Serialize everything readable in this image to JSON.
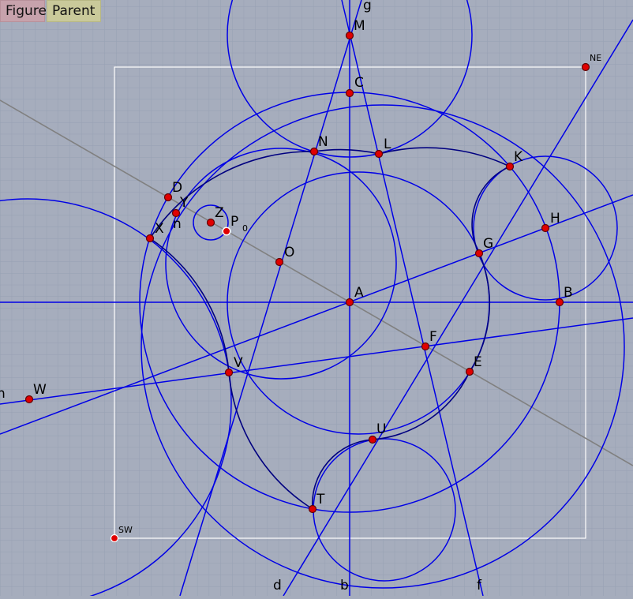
{
  "toolbar": {
    "figure_label": "Figure",
    "parent_label": "Parent"
  },
  "colors": {
    "background": "#a6adbd",
    "grid": "#97a0b3",
    "construction_blue": "#0000e6",
    "arc_dark_blue": "#000080",
    "gray_line": "#808080",
    "frame": "#ffffff",
    "point_fill": "#e00000",
    "point_stroke": "#600000"
  },
  "points": {
    "M": "M",
    "C": "C",
    "N": "N",
    "L": "L",
    "K": "K",
    "NE": "NE",
    "D": "D",
    "Y": "Y",
    "Z": "Z",
    "P": "P",
    "P_sub": "0",
    "n": "n",
    "X": "X",
    "O": "O",
    "H": "H",
    "G": "G",
    "A": "A",
    "B": "B",
    "F": "F",
    "E": "E",
    "V": "V",
    "W": "W",
    "U": "U",
    "T": "T",
    "SW": "SW"
  },
  "line_labels": {
    "g": "g",
    "d": "d",
    "b": "b",
    "f": "f",
    "h": "h"
  }
}
